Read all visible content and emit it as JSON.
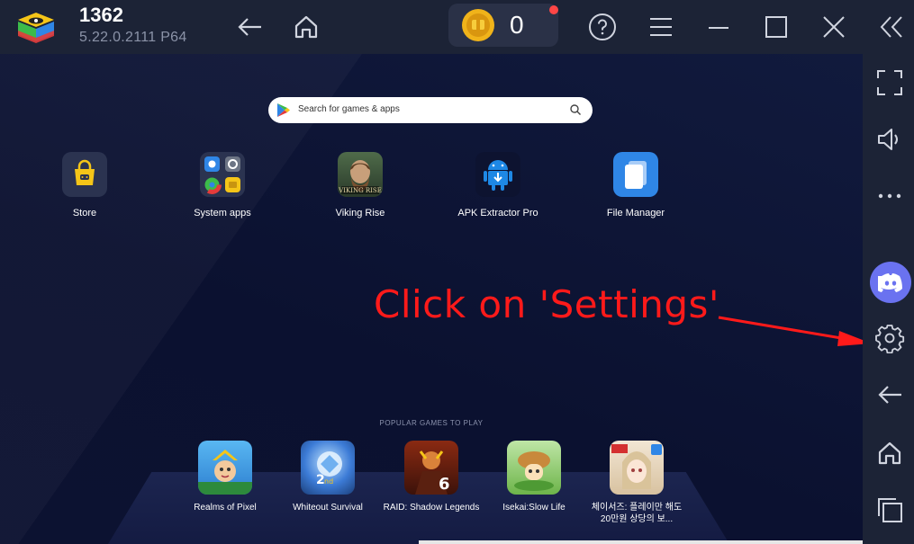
{
  "titlebar": {
    "app_name": "1362",
    "version": "5.22.0.2111  P64",
    "coins": "0"
  },
  "search": {
    "placeholder": "Search for games & apps"
  },
  "apps": [
    {
      "label": "Store"
    },
    {
      "label": "System apps"
    },
    {
      "label": "Viking Rise"
    },
    {
      "label": "APK Extractor Pro"
    },
    {
      "label": "File Manager"
    }
  ],
  "instruction": "Click on 'Settings'",
  "popular": {
    "title": "POPULAR GAMES TO PLAY",
    "games": [
      {
        "label": "Realms of Pixel"
      },
      {
        "label": "Whiteout Survival"
      },
      {
        "label": "RAID: Shadow Legends"
      },
      {
        "label": "Isekai:Slow Life"
      },
      {
        "label": "체이서즈: 플레이만 해도 20만원 상당의 보..."
      }
    ]
  },
  "colors": {
    "accent_red": "#ff1a1a",
    "discord": "#6a72f0",
    "titlebar_bg": "#1c2336",
    "main_bg": "#0d1330"
  }
}
